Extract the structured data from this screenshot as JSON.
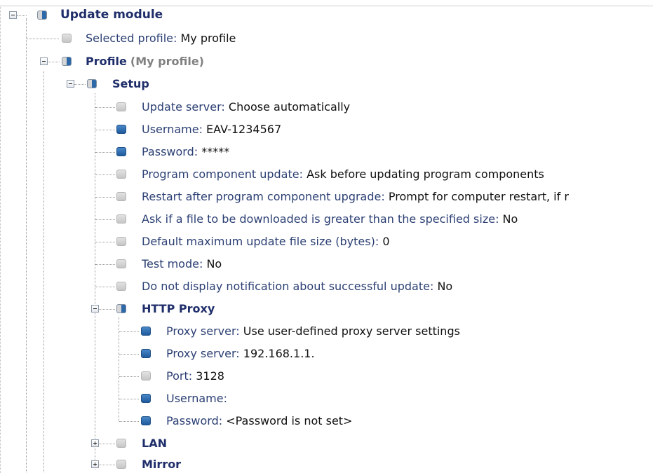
{
  "tree": {
    "root": {
      "label": "Update module"
    },
    "selected_profile": {
      "key": "Selected profile",
      "value": "My profile"
    },
    "profile": {
      "label": "Profile",
      "suffix": "(My profile)"
    },
    "setup": {
      "label": "Setup",
      "items": [
        {
          "key": "Update server",
          "value": "Choose automatically",
          "state": "grey"
        },
        {
          "key": "Username",
          "value": "EAV-1234567",
          "state": "blue"
        },
        {
          "key": "Password",
          "value": "*****",
          "state": "blue"
        },
        {
          "key": "Program component update",
          "value": "Ask before updating program components",
          "state": "grey"
        },
        {
          "key": "Restart after program component upgrade",
          "value": "Prompt for computer restart, if r",
          "state": "grey"
        },
        {
          "key": "Ask if a file to be downloaded is greater than the specified size",
          "value": "No",
          "state": "grey"
        },
        {
          "key": "Default maximum update file size (bytes)",
          "value": "0",
          "state": "grey"
        },
        {
          "key": "Test mode",
          "value": "No",
          "state": "grey"
        },
        {
          "key": "Do not display notification about successful update",
          "value": "No",
          "state": "grey"
        }
      ]
    },
    "http_proxy": {
      "label": "HTTP Proxy",
      "items": [
        {
          "key": "Proxy server",
          "value": "Use user-defined proxy server settings",
          "state": "blue"
        },
        {
          "key": "Proxy server",
          "value": "192.168.1.1.",
          "state": "blue"
        },
        {
          "key": "Port",
          "value": "3128",
          "state": "grey"
        },
        {
          "key": "Username",
          "value": "",
          "state": "blue"
        },
        {
          "key": "Password",
          "value": "<Password is not set>",
          "state": "blue"
        }
      ]
    },
    "lan": {
      "label": "LAN"
    },
    "mirror": {
      "label": "Mirror"
    }
  },
  "colors": {
    "key_text": "#2b3f73",
    "icon_blue": "#2d68a8",
    "icon_grey": "#d0d0d0",
    "connector": "#9a9a9a"
  }
}
